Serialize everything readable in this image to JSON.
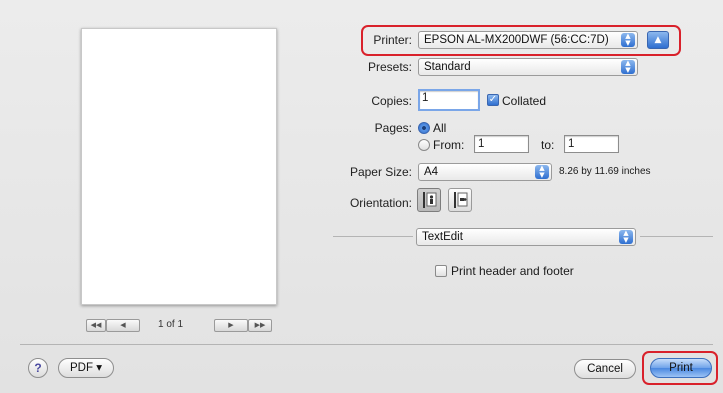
{
  "preview": {
    "first_label": "◀◀",
    "prev_label": "◀",
    "page_text": "1 of 1",
    "next_label": "▶",
    "last_label": "▶▶"
  },
  "printer": {
    "label": "Printer:",
    "value": "EPSON AL-MX200DWF (56:CC:7D)"
  },
  "presets": {
    "label": "Presets:",
    "value": "Standard"
  },
  "copies": {
    "label": "Copies:",
    "value": "1",
    "collated_label": "Collated",
    "collated": true
  },
  "pages": {
    "label": "Pages:",
    "all_label": "All",
    "from_label": "From:",
    "from_value": "1",
    "to_label": "to:",
    "to_value": "1",
    "selected": "All"
  },
  "paper": {
    "label": "Paper Size:",
    "value": "A4",
    "dimensions": "8.26 by 11.69 inches"
  },
  "orientation": {
    "label": "Orientation:",
    "selected": "portrait"
  },
  "app_section": {
    "value": "TextEdit",
    "header_footer_label": "Print header and footer",
    "header_footer": false
  },
  "footer": {
    "help_label": "?",
    "pdf_label": "PDF ▾",
    "cancel_label": "Cancel",
    "print_label": "Print"
  },
  "colors": {
    "accent": "#2f6fd0",
    "highlight": "#d9212b"
  }
}
